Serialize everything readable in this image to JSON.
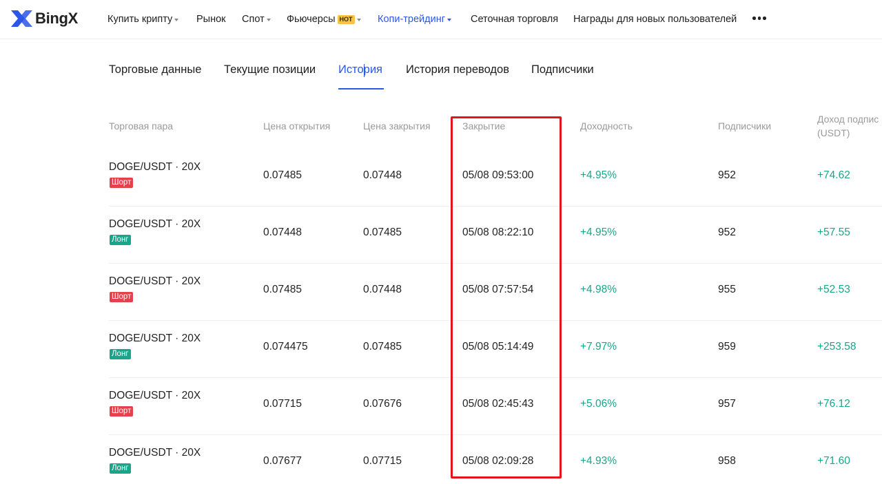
{
  "brand": {
    "name": "BingX",
    "accent_color": "#2c56e6",
    "positive_color": "#1aa58a",
    "short_color": "#e2424b",
    "highlight_color": "#e2141c"
  },
  "nav": {
    "items": [
      {
        "label": "Купить крипту",
        "has_dropdown": true
      },
      {
        "label": "Рынок"
      },
      {
        "label": "Спот",
        "has_dropdown": true
      },
      {
        "label": "Фьючерсы",
        "badge": "HOT",
        "has_dropdown": true
      },
      {
        "label": "Копи-трейдинг",
        "has_dropdown": true,
        "active": true
      },
      {
        "label": "Сеточная торговля"
      },
      {
        "label": "Награды для новых пользователей"
      }
    ],
    "more_icon": "more-horizontal-icon"
  },
  "tabs": [
    {
      "label": "Торговые данные"
    },
    {
      "label": "Текущие позиции"
    },
    {
      "label": "История",
      "active": true
    },
    {
      "label": "История переводов"
    },
    {
      "label": "Подписчики"
    }
  ],
  "table": {
    "headers": {
      "pair": "Торговая пара",
      "open_price": "Цена открытия",
      "close_price": "Цена закрытия",
      "close_time": "Закрытие",
      "yield": "Доходность",
      "followers": "Подписчики",
      "income_line1": "Доход подпис",
      "income_line2": "(USDT)"
    },
    "rows": [
      {
        "pair": "DOGE/USDT · 20X",
        "side": "Шорт",
        "side_type": "short",
        "open_price": "0.07485",
        "close_price": "0.07448",
        "close_time": "05/08 09:53:00",
        "yield": "+4.95%",
        "followers": "952",
        "income": "+74.62"
      },
      {
        "pair": "DOGE/USDT · 20X",
        "side": "Лонг",
        "side_type": "long",
        "open_price": "0.07448",
        "close_price": "0.07485",
        "close_time": "05/08 08:22:10",
        "yield": "+4.95%",
        "followers": "952",
        "income": "+57.55"
      },
      {
        "pair": "DOGE/USDT · 20X",
        "side": "Шорт",
        "side_type": "short",
        "open_price": "0.07485",
        "close_price": "0.07448",
        "close_time": "05/08 07:57:54",
        "yield": "+4.98%",
        "followers": "955",
        "income": "+52.53"
      },
      {
        "pair": "DOGE/USDT · 20X",
        "side": "Лонг",
        "side_type": "long",
        "open_price": "0.074475",
        "close_price": "0.07485",
        "close_time": "05/08 05:14:49",
        "yield": "+7.97%",
        "followers": "959",
        "income": "+253.58"
      },
      {
        "pair": "DOGE/USDT · 20X",
        "side": "Шорт",
        "side_type": "short",
        "open_price": "0.07715",
        "close_price": "0.07676",
        "close_time": "05/08 02:45:43",
        "yield": "+5.06%",
        "followers": "957",
        "income": "+76.12"
      },
      {
        "pair": "DOGE/USDT · 20X",
        "side": "Лонг",
        "side_type": "long",
        "open_price": "0.07677",
        "close_price": "0.07715",
        "close_time": "05/08 02:09:28",
        "yield": "+4.93%",
        "followers": "958",
        "income": "+71.60"
      }
    ]
  }
}
